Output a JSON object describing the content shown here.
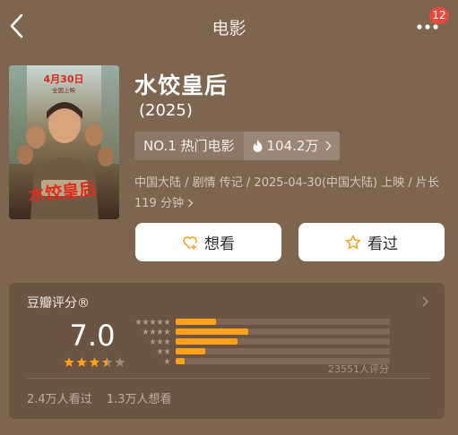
{
  "nav": {
    "title": "电影",
    "badge": "12"
  },
  "movie": {
    "title": "水饺皇后",
    "year": "(2025)",
    "rank_label": "NO.1 热门电影",
    "heat": "104.2万",
    "info": "中国大陆 / 剧情 传记 / 2025-04-30(中国大陆) 上映 / 片长 119 分钟",
    "poster": {
      "date_text": "4月30日",
      "release_text": "全国上映",
      "title_text": "水饺皇后"
    }
  },
  "actions": {
    "want_label": "想看",
    "seen_label": "看过"
  },
  "rating": {
    "section_title": "豆瓣评分®",
    "score": "7.0",
    "stars": 3.5,
    "distribution": [
      {
        "stars": 5,
        "percent": 19
      },
      {
        "stars": 4,
        "percent": 34
      },
      {
        "stars": 3,
        "percent": 29
      },
      {
        "stars": 2,
        "percent": 14
      },
      {
        "stars": 1,
        "percent": 4
      }
    ],
    "count_text": "23551人评分",
    "watched_text": "2.4万人看过",
    "wish_text": "1.3万人想看"
  },
  "colors": {
    "accent": "#ffa11a",
    "background": "#7e6550",
    "card": "#6c5443",
    "badge": "#e94a3f"
  }
}
